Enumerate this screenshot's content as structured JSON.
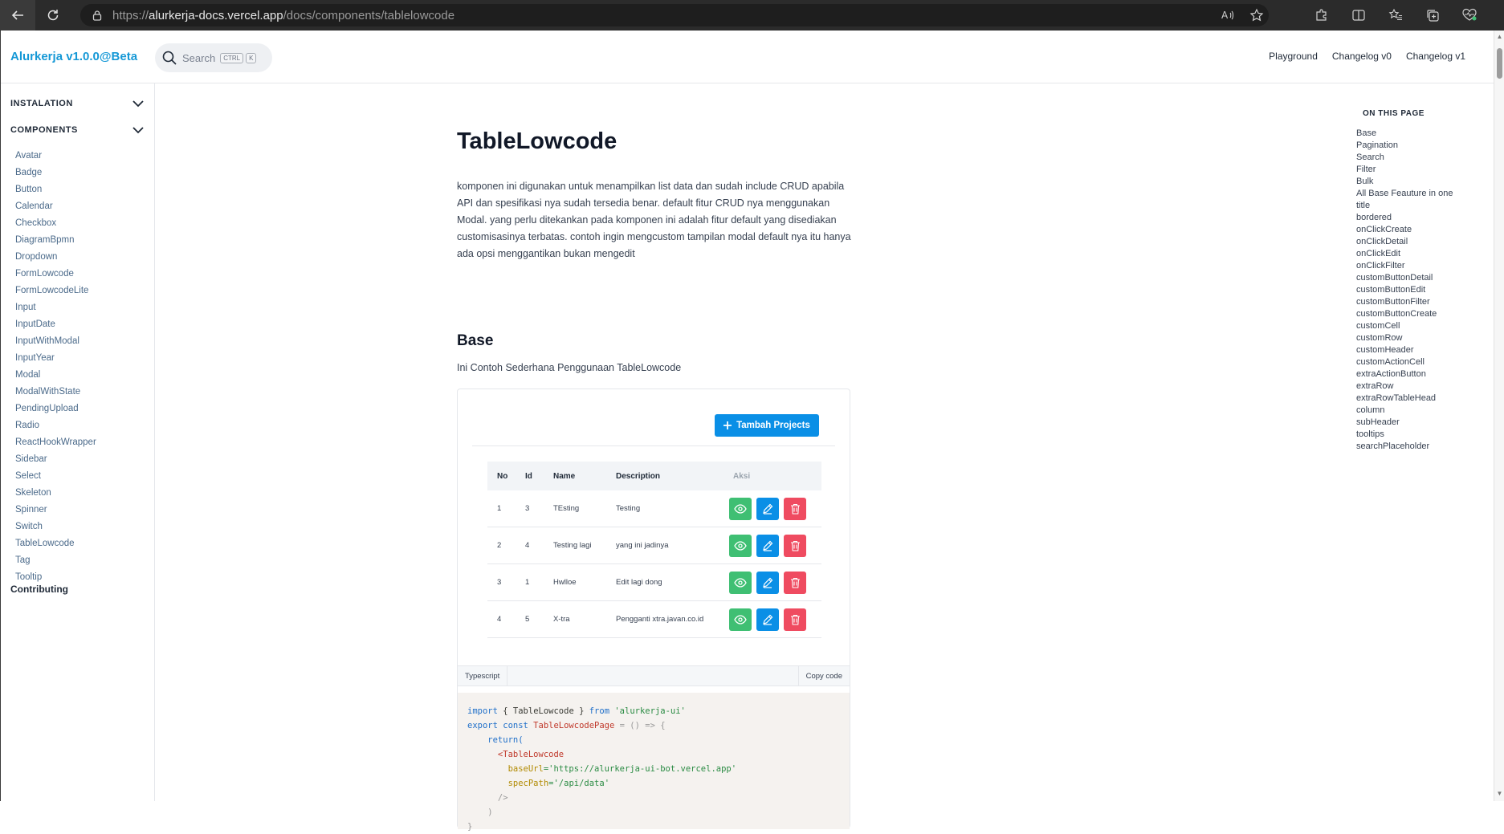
{
  "browser": {
    "url_prefix": "https://",
    "url_host": "alurkerja-docs.vercel.app",
    "url_path": "/docs/components/tablelowcode"
  },
  "header": {
    "brand": "Alurkerja v1.0.0@Beta",
    "search_placeholder": "Search",
    "kbd_ctrl": "CTRL",
    "kbd_k": "K",
    "links": [
      "Playground",
      "Changelog v0",
      "Changelog v1"
    ]
  },
  "sidebar": {
    "section_installation": "INSTALATION",
    "section_components": "COMPONENTS",
    "items": [
      "Avatar",
      "Badge",
      "Button",
      "Calendar",
      "Checkbox",
      "DiagramBpmn",
      "Dropdown",
      "FormLowcode",
      "FormLowcodeLite",
      "Input",
      "InputDate",
      "InputWithModal",
      "InputYear",
      "Modal",
      "ModalWithState",
      "PendingUpload",
      "Radio",
      "ReactHookWrapper",
      "Sidebar",
      "Select",
      "Skeleton",
      "Spinner",
      "Switch",
      "TableLowcode",
      "Tag",
      "Tooltip"
    ],
    "contributing": "Contributing"
  },
  "main": {
    "title": "TableLowcode",
    "intro": "komponen ini digunakan untuk menampilkan list data dan sudah include CRUD apabila API dan spesifikasi nya sudah tersedia benar. default fitur CRUD nya menggunakan Modal. yang perlu ditekankan pada komponen ini adalah fitur default yang disediakan customisasinya terbatas. contoh ingin mengcustom tampilan modal default nya itu hanya ada opsi menggantikan bukan mengedit",
    "base_heading": "Base",
    "base_subtitle": "Ini Contoh Sederhana Penggunaan TableLowcode",
    "add_button": "Tambah Projects",
    "table_headers": [
      "No",
      "Id",
      "Name",
      "Description",
      "Aksi"
    ],
    "rows": [
      {
        "no": "1",
        "id": "3",
        "name": "TEsting",
        "desc": "Testing"
      },
      {
        "no": "2",
        "id": "4",
        "name": "Testing lagi",
        "desc": "yang ini jadinya"
      },
      {
        "no": "3",
        "id": "1",
        "name": "Hwlloe",
        "desc": "Edit lagi dong"
      },
      {
        "no": "4",
        "id": "5",
        "name": "X-tra",
        "desc": "Pengganti xtra.javan.co.id"
      }
    ],
    "code_lang": "Typescript",
    "copy_code": "Copy code",
    "code": {
      "l1_a": "import",
      "l1_b": " { TableLowcode } ",
      "l1_c": "from",
      "l1_d": " 'alurkerja-ui'",
      "l2_a": "export const",
      "l2_b": " TableLowcodePage",
      "l2_c": " = () => {",
      "l3": "    return(",
      "l4": "      <TableLowcode",
      "l5_a": "        baseUrl",
      "l5_b": "='https://alurkerja-ui-bot.vercel.app'",
      "l6_a": "        specPath",
      "l6_b": "='/api/data'",
      "l7": "      />",
      "l8": "    )",
      "l9": "}"
    }
  },
  "toc": {
    "title": "ON THIS PAGE",
    "items": [
      "Base",
      "Pagination",
      "Search",
      "Filter",
      "Bulk",
      "All Base Feauture in one",
      "title",
      "bordered",
      "onClickCreate",
      "onClickDetail",
      "onClickEdit",
      "onClickFilter",
      "customButtonDetail",
      "customButtonEdit",
      "customButtonFilter",
      "customButtonCreate",
      "customCell",
      "customRow",
      "customHeader",
      "customActionCell",
      "extraActionButton",
      "extraRow",
      "extraRowTableHead",
      "column",
      "subHeader",
      "tooltips",
      "searchPlaceholder"
    ]
  },
  "colors": {
    "brand": "#1598d6",
    "primary": "#0a8fe6",
    "view": "#3fbf73",
    "delete": "#ef4b60"
  }
}
